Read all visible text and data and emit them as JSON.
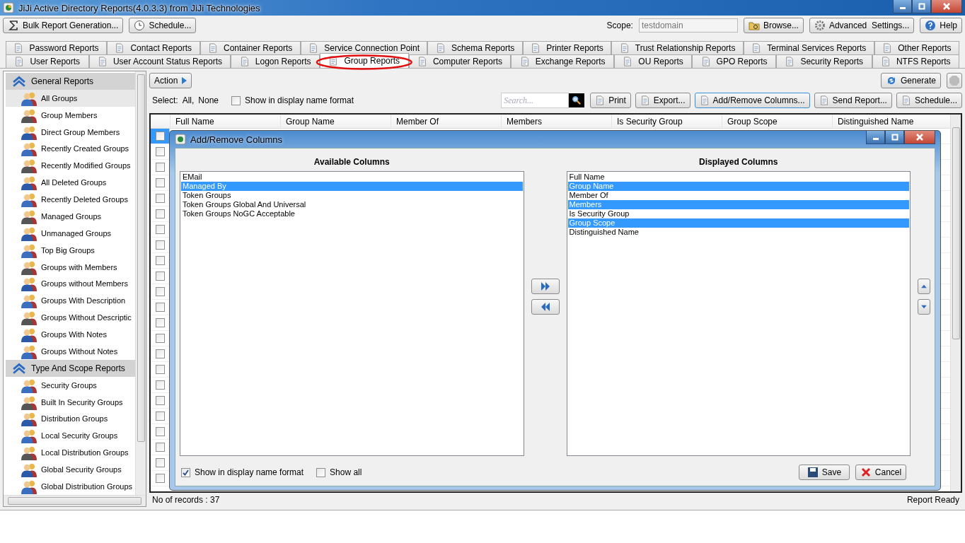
{
  "window": {
    "title": "JiJi Active Directory Reports(4.0.3.3) from JiJi Technologies"
  },
  "toolbar": {
    "left_buttons": [
      {
        "label": "Bulk Report Generation...",
        "kind": "sigma"
      },
      {
        "label": "Schedule...",
        "kind": "clock"
      }
    ],
    "scope_label": "Scope:",
    "scope_value": "testdomain",
    "right_buttons": [
      {
        "label": "Browse...",
        "kind": "folder"
      },
      {
        "label": "Advanced  Settings...",
        "kind": "gear"
      },
      {
        "label": "Help",
        "kind": "help"
      }
    ]
  },
  "tabs_back": [
    {
      "label": "Password Reports",
      "selected": false
    },
    {
      "label": "Contact Reports",
      "selected": false
    },
    {
      "label": "Container Reports",
      "selected": false
    },
    {
      "label": "Service Connection Point",
      "selected": false
    },
    {
      "label": "Schema Reports",
      "selected": false
    },
    {
      "label": "Printer Reports",
      "selected": false
    },
    {
      "label": "Trust Relationship Reports",
      "selected": false
    },
    {
      "label": "Terminal Services Reports",
      "selected": false
    },
    {
      "label": "Other Reports",
      "selected": false
    }
  ],
  "tabs_front": [
    {
      "label": "User Reports",
      "selected": false,
      "highlighted": false
    },
    {
      "label": "User Account Status Reports",
      "selected": false,
      "highlighted": false
    },
    {
      "label": "Logon Reports",
      "selected": false,
      "highlighted": false
    },
    {
      "label": "Group Reports",
      "selected": true,
      "highlighted": true
    },
    {
      "label": "Computer Reports",
      "selected": false,
      "highlighted": false
    },
    {
      "label": "Exchange Reports",
      "selected": false,
      "highlighted": false
    },
    {
      "label": "OU Reports",
      "selected": false,
      "highlighted": false
    },
    {
      "label": "GPO Reports",
      "selected": false,
      "highlighted": false
    },
    {
      "label": "Security Reports",
      "selected": false,
      "highlighted": false
    },
    {
      "label": "NTFS Reports",
      "selected": false,
      "highlighted": false
    }
  ],
  "sidebar": {
    "sections": [
      {
        "title": "General Reports",
        "expanded": true,
        "items": [
          {
            "label": "All Groups",
            "selected": true
          },
          {
            "label": "Group Members",
            "selected": false
          },
          {
            "label": "Direct Group Members",
            "selected": false
          },
          {
            "label": "Recently Created Groups",
            "selected": false
          },
          {
            "label": "Recently Modified Groups",
            "selected": false
          },
          {
            "label": "All Deleted Groups",
            "selected": false
          },
          {
            "label": "Recently Deleted Groups",
            "selected": false
          },
          {
            "label": "Managed Groups",
            "selected": false
          },
          {
            "label": "Unmanaged Groups",
            "selected": false
          },
          {
            "label": "Top Big Groups",
            "selected": false
          },
          {
            "label": "Groups with Members",
            "selected": false
          },
          {
            "label": "Groups without Members",
            "selected": false
          },
          {
            "label": "Groups With Description",
            "selected": false
          },
          {
            "label": "Groups Without Descriptic",
            "selected": false
          },
          {
            "label": "Groups With Notes",
            "selected": false
          },
          {
            "label": "Groups Without Notes",
            "selected": false
          }
        ]
      },
      {
        "title": "Type And Scope Reports",
        "expanded": true,
        "items": [
          {
            "label": "Security Groups",
            "selected": false
          },
          {
            "label": "Built In Security Groups",
            "selected": false
          },
          {
            "label": "Distribution Groups",
            "selected": false
          },
          {
            "label": "Local Security Groups",
            "selected": false
          },
          {
            "label": "Local Distribution Groups",
            "selected": false
          },
          {
            "label": "Global Security Groups",
            "selected": false
          },
          {
            "label": "Global Distribution Groups",
            "selected": false
          }
        ]
      }
    ]
  },
  "action": {
    "label": "Action"
  },
  "generate": {
    "label": "Generate"
  },
  "select": {
    "label": "Select:",
    "all": "All,",
    "none": "None"
  },
  "display_name_checkbox": {
    "label": "Show in display name format",
    "checked": false
  },
  "search": {
    "placeholder": "Search..."
  },
  "report_buttons": [
    {
      "label": "Print",
      "focused": false
    },
    {
      "label": "Export...",
      "focused": false
    },
    {
      "label": "Add/Remove Columns...",
      "focused": true
    },
    {
      "label": "Send Report...",
      "focused": false
    },
    {
      "label": "Schedule...",
      "focused": false
    }
  ],
  "grid": {
    "columns": [
      "Full Name",
      "Group Name",
      "Member Of",
      "Members",
      "Is Security Group",
      "Group Scope",
      "Distinguished Name"
    ],
    "rows": [
      {
        "selected": true,
        "checked": false
      },
      {
        "selected": false,
        "checked": false
      },
      {
        "selected": false,
        "checked": false
      },
      {
        "selected": false,
        "checked": false
      },
      {
        "selected": false,
        "checked": false
      },
      {
        "selected": false,
        "checked": false
      },
      {
        "selected": false,
        "checked": false
      },
      {
        "selected": false,
        "checked": false
      },
      {
        "selected": false,
        "checked": false
      },
      {
        "selected": false,
        "checked": false
      },
      {
        "selected": false,
        "checked": false
      },
      {
        "selected": false,
        "checked": false
      },
      {
        "selected": false,
        "checked": false
      },
      {
        "selected": false,
        "checked": false
      },
      {
        "selected": false,
        "checked": false
      },
      {
        "selected": false,
        "checked": false
      },
      {
        "selected": false,
        "checked": false
      },
      {
        "selected": false,
        "checked": false
      },
      {
        "selected": false,
        "checked": false
      },
      {
        "selected": false,
        "checked": false
      },
      {
        "selected": false,
        "checked": false
      },
      {
        "selected": false,
        "checked": false
      },
      {
        "selected": false,
        "checked": false
      }
    ]
  },
  "dialog": {
    "title": "Add/Remove Columns",
    "available": {
      "heading": "Available Columns",
      "items": [
        {
          "label": "EMail",
          "selected": false
        },
        {
          "label": "Managed By",
          "selected": true
        },
        {
          "label": "Token Groups",
          "selected": false
        },
        {
          "label": "Token Groups Global And Universal",
          "selected": false
        },
        {
          "label": "Token Groups NoGC Acceptable",
          "selected": false
        }
      ]
    },
    "displayed": {
      "heading": "Displayed Columns",
      "items": [
        {
          "label": "Full Name",
          "selected": false
        },
        {
          "label": "Group Name",
          "selected": true
        },
        {
          "label": "Member Of",
          "selected": false
        },
        {
          "label": "Members",
          "selected": true
        },
        {
          "label": "Is Security Group",
          "selected": false
        },
        {
          "label": "Group Scope",
          "selected": true
        },
        {
          "label": "Distinguished Name",
          "selected": false
        }
      ]
    },
    "show_display_name": {
      "label": "Show in display name format",
      "checked": true
    },
    "show_all": {
      "label": "Show all",
      "checked": false
    },
    "buttons": [
      {
        "label": "Save",
        "kind": "save"
      },
      {
        "label": "Cancel",
        "kind": "cancel"
      }
    ]
  },
  "status_bar": {
    "records": "No of records : 37",
    "status": "Report Ready"
  }
}
